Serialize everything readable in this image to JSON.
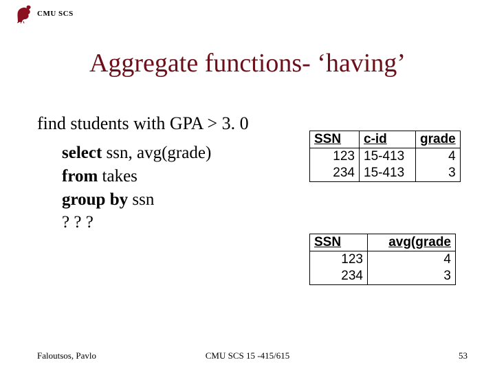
{
  "header": {
    "org": "CMU SCS"
  },
  "title": "Aggregate functions- ‘having’",
  "subtitle": "find students with GPA > 3. 0",
  "query": {
    "l1a": "select",
    "l1b": " ssn, avg(grade)",
    "l2a": "from",
    "l2b": " takes",
    "l3a": "group by",
    "l3b": " ssn",
    "l4": "? ? ?"
  },
  "table1": {
    "cols": [
      "SSN",
      "c-id",
      "grade"
    ],
    "rows": [
      [
        "123",
        "15-413",
        "4"
      ],
      [
        "234",
        "15-413",
        "3"
      ]
    ]
  },
  "table2": {
    "cols": [
      "SSN",
      "avg(grade"
    ],
    "rows": [
      [
        "123",
        "4"
      ],
      [
        "234",
        "3"
      ]
    ]
  },
  "footer": {
    "left": "Faloutsos, Pavlo",
    "mid": "CMU SCS 15 -415/615",
    "right": "53"
  }
}
